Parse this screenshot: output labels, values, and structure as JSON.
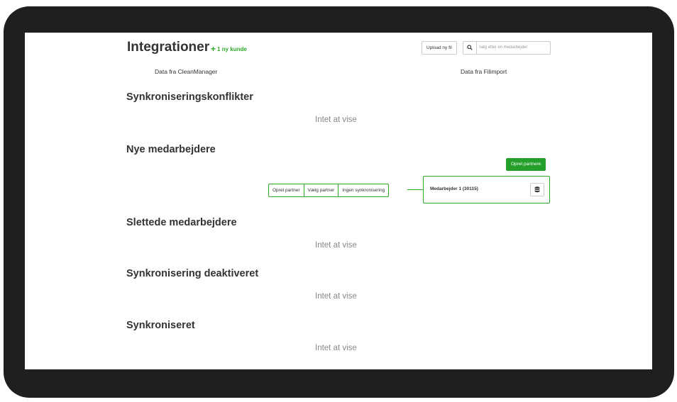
{
  "header": {
    "title": "Integrationer",
    "badge_plus": "+",
    "badge": "1 ny kunde",
    "upload_label": "Upload ny fil",
    "search_placeholder": "Søg efter en medarbejder"
  },
  "columns": {
    "left": "Data fra CleanManager",
    "right": "Data fra Filimport"
  },
  "sections": {
    "conflicts": {
      "title": "Synkroniseringskonflikter",
      "empty": "Intet at vise"
    },
    "new": {
      "title": "Nye medarbejdere",
      "create_partners_label": "Opret partnere",
      "actions": [
        "Opret partner",
        "Vælg partner",
        "Ingen synkronisering"
      ],
      "employee": "Medarbejder 1 (30115)"
    },
    "deleted": {
      "title": "Slettede medarbejdere",
      "empty": "Intet at vise"
    },
    "disabled": {
      "title": "Synkronisering deaktiveret",
      "empty": "Intet at vise"
    },
    "synced": {
      "title": "Synkroniseret",
      "empty": "Intet at vise"
    }
  },
  "icons": {
    "search": "search-icon",
    "database": "database-icon"
  },
  "colors": {
    "accent": "#24a02a",
    "frame": "#1f1f1f"
  }
}
